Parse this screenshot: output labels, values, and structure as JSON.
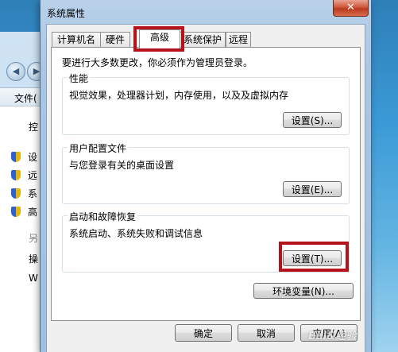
{
  "background_window": {
    "menu_label": "文件(",
    "items": [
      "控",
      "设",
      "远",
      "系",
      "高",
      "另",
      "操",
      "W"
    ]
  },
  "dialog": {
    "title": "系统属性",
    "close_glyph": "✕",
    "tabs": [
      "计算机名",
      "硬件",
      "高级",
      "系统保护",
      "远程"
    ],
    "active_tab": "高级",
    "notice": "要进行大多数更改，你必须作为管理员登录。",
    "groups": [
      {
        "label": "性能",
        "description": "视觉效果，处理器计划，内存使用，以及及虚拟内存",
        "button": "设置(S)..."
      },
      {
        "label": "用户配置文件",
        "description": "与您登录有关的桌面设置",
        "button": "设置(E)..."
      },
      {
        "label": "启动和故障恢复",
        "description": "系统启动、系统失败和调试信息",
        "button": "设置(T)..."
      }
    ],
    "env_button": "环境变量(N)...",
    "footer": {
      "ok": "确定",
      "cancel": "取消",
      "apply": "应用(A)"
    }
  },
  "watermark": "Bai&经验",
  "colors": {
    "highlight": "#b5121b",
    "close_button": "#c9472b",
    "title_bar": "#b9d1ea"
  }
}
